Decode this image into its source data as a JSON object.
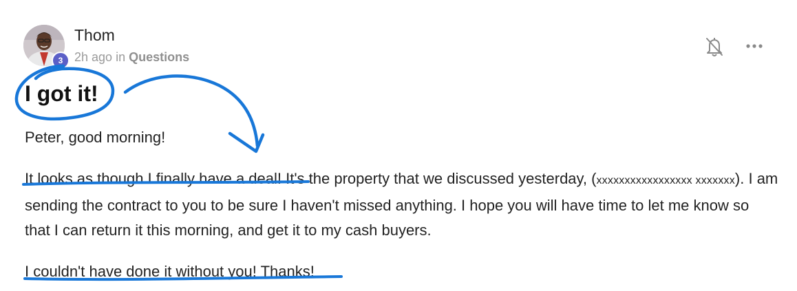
{
  "author": {
    "name": "Thom",
    "level": "3",
    "time_ago": "2h ago",
    "in_label": "in",
    "category": "Questions"
  },
  "icons": {
    "notification": "bell-off-icon",
    "more": "more-horizontal-icon"
  },
  "post": {
    "title": "I got it!",
    "greeting": "Peter, good morning!",
    "para1_start": "It looks as though I finally have a deal! It's the property that we discussed yesterday, (",
    "para1_redacted": "xxxxxxxxxxxxxxxxx xxxxxxx",
    "para1_end": "). I am sending the contract to you to be sure I haven't missed anything. I hope you will have time to let me know so that I can return it this morning, and get it to my cash buyers.",
    "closing": "I couldn't have done it without you! Thanks!"
  },
  "colors": {
    "annotation_blue": "#1877d8",
    "badge_purple": "#5b5fc7",
    "meta_gray": "#9a9a9a"
  }
}
